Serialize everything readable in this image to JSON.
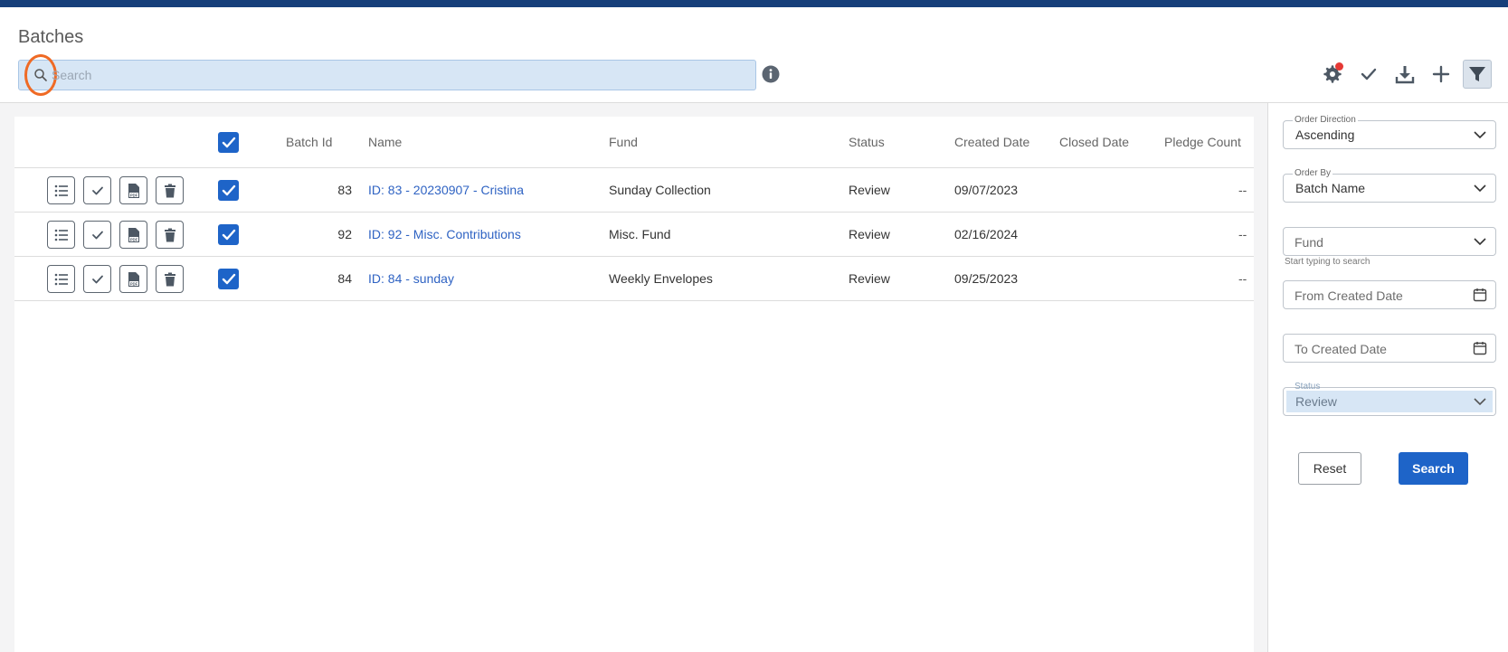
{
  "header": {
    "title": "Batches",
    "search_placeholder": "Search"
  },
  "toolbar": {
    "icons": [
      "gear-icon",
      "check-icon",
      "download-icon",
      "plus-icon",
      "filter-icon"
    ],
    "badge_color": "#e53935"
  },
  "table": {
    "columns": [
      "Batch Id",
      "Name",
      "Fund",
      "Status",
      "Created Date",
      "Closed Date",
      "Pledge Count"
    ],
    "rows": [
      {
        "batch_id": "83",
        "name": "ID: 83 - 20230907 - Cristina",
        "fund": "Sunday Collection",
        "status": "Review",
        "created": "09/07/2023",
        "closed": "",
        "pledge_count": "--"
      },
      {
        "batch_id": "92",
        "name": "ID: 92 - Misc. Contributions",
        "fund": "Misc. Fund",
        "status": "Review",
        "created": "02/16/2024",
        "closed": "",
        "pledge_count": "--"
      },
      {
        "batch_id": "84",
        "name": "ID: 84 - sunday",
        "fund": "Weekly Envelopes",
        "status": "Review",
        "created": "09/25/2023",
        "closed": "",
        "pledge_count": "--"
      }
    ]
  },
  "filters": {
    "order_direction": {
      "label": "Order Direction",
      "value": "Ascending"
    },
    "order_by": {
      "label": "Order By",
      "value": "Batch Name"
    },
    "fund": {
      "placeholder": "Fund",
      "hint": "Start typing to search"
    },
    "from_date": {
      "placeholder": "From Created Date"
    },
    "to_date": {
      "placeholder": "To Created Date"
    },
    "status": {
      "label": "Status",
      "value": "Review"
    },
    "reset_label": "Reset",
    "search_label": "Search"
  },
  "colors": {
    "accent": "#1e64c8",
    "topbar": "#163f7a",
    "link": "#2f63c3",
    "highlight": "#ef6a25"
  }
}
